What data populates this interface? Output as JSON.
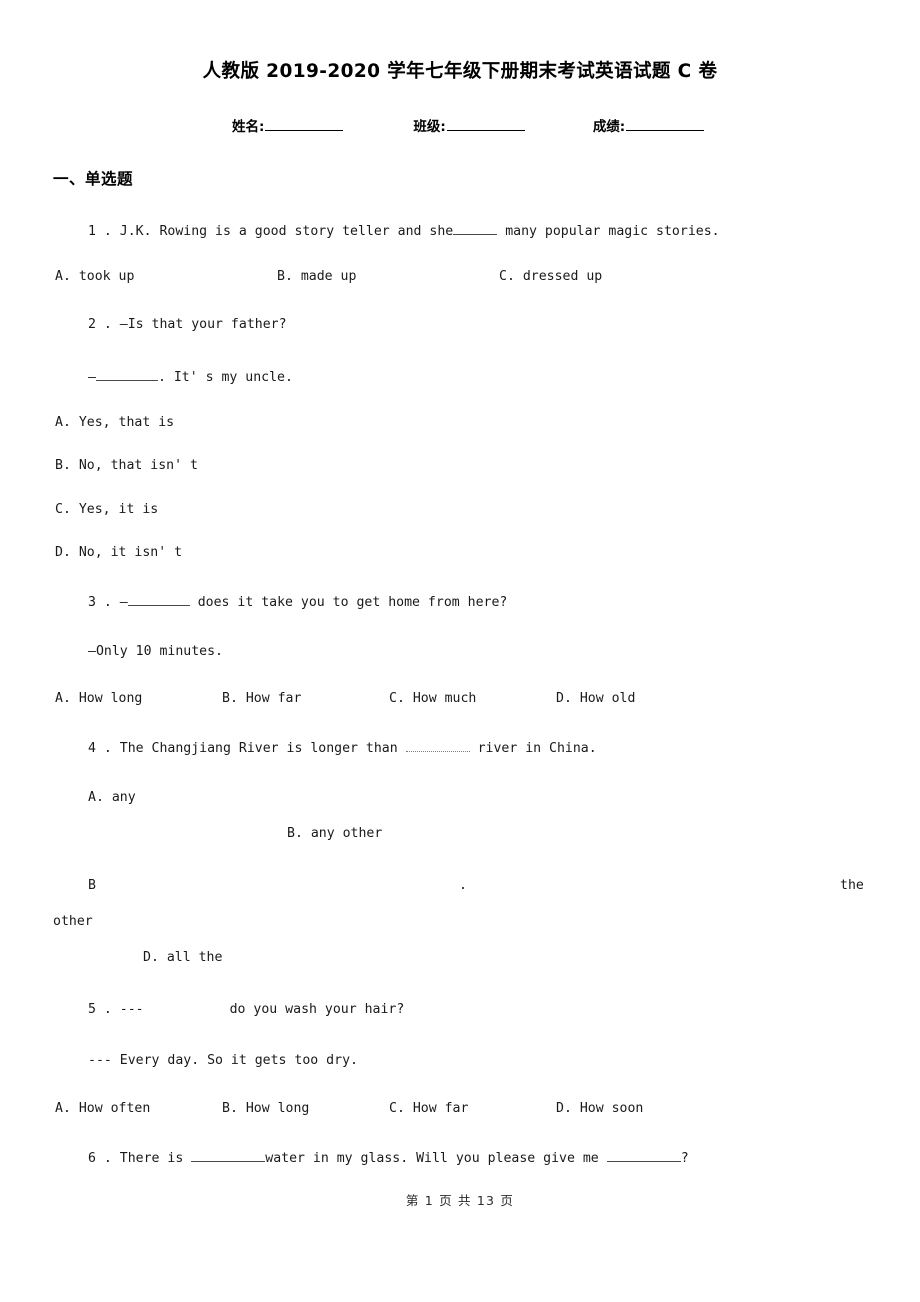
{
  "document": {
    "title": "人教版 2019-2020 学年七年级下册期末考试英语试题 C 卷",
    "identity": {
      "name_label": "姓名:",
      "class_label": "班级:",
      "score_label": "成绩:"
    },
    "section_heading": "一、单选题",
    "footer": "第 1 页 共 13 页"
  },
  "questions": [
    {
      "number": "1 .",
      "stem_before": "J.K. Rowing is a good story teller and she",
      "stem_after": "many popular magic stories.",
      "options": [
        {
          "label": "A. took up"
        },
        {
          "label": "B. made up"
        },
        {
          "label": "C. dressed up"
        }
      ]
    },
    {
      "number": "2 .",
      "stem": "—Is that your father?",
      "reply_before": "—",
      "reply_after": ". It' s my uncle.",
      "options": [
        {
          "label": "A. Yes, that is"
        },
        {
          "label": "B. No, that isn' t"
        },
        {
          "label": "C. Yes, it is"
        },
        {
          "label": "D. No, it isn' t"
        }
      ]
    },
    {
      "number": "3 .",
      "stem_before": "—",
      "stem_after": "does it take you to get home from here?",
      "reply": "—Only 10 minutes.",
      "options": [
        {
          "label": "A. How long"
        },
        {
          "label": "B. How far"
        },
        {
          "label": "C. How much"
        },
        {
          "label": "D. How old"
        }
      ]
    },
    {
      "number": "4 .",
      "stem_before": "The Changjiang River is longer than",
      "stem_after": "river in China.",
      "options": [
        {
          "label": "A. any"
        },
        {
          "label": "B. any other"
        },
        {
          "label": "B"
        },
        {
          "label": "."
        },
        {
          "label": "the"
        },
        {
          "label": "other"
        },
        {
          "label": "D. all the"
        }
      ]
    },
    {
      "number": "5 .",
      "stem_dash": "---",
      "stem_after": "do you wash your hair?",
      "reply": "--- Every day. So it gets too dry.",
      "options": [
        {
          "label": "A. How often"
        },
        {
          "label": "B. How long"
        },
        {
          "label": "C. How far"
        },
        {
          "label": "D. How soon"
        }
      ]
    },
    {
      "number": "6 .",
      "stem_a": "There is",
      "stem_b": "water in my glass. Will you please give me",
      "stem_c": "?"
    }
  ]
}
